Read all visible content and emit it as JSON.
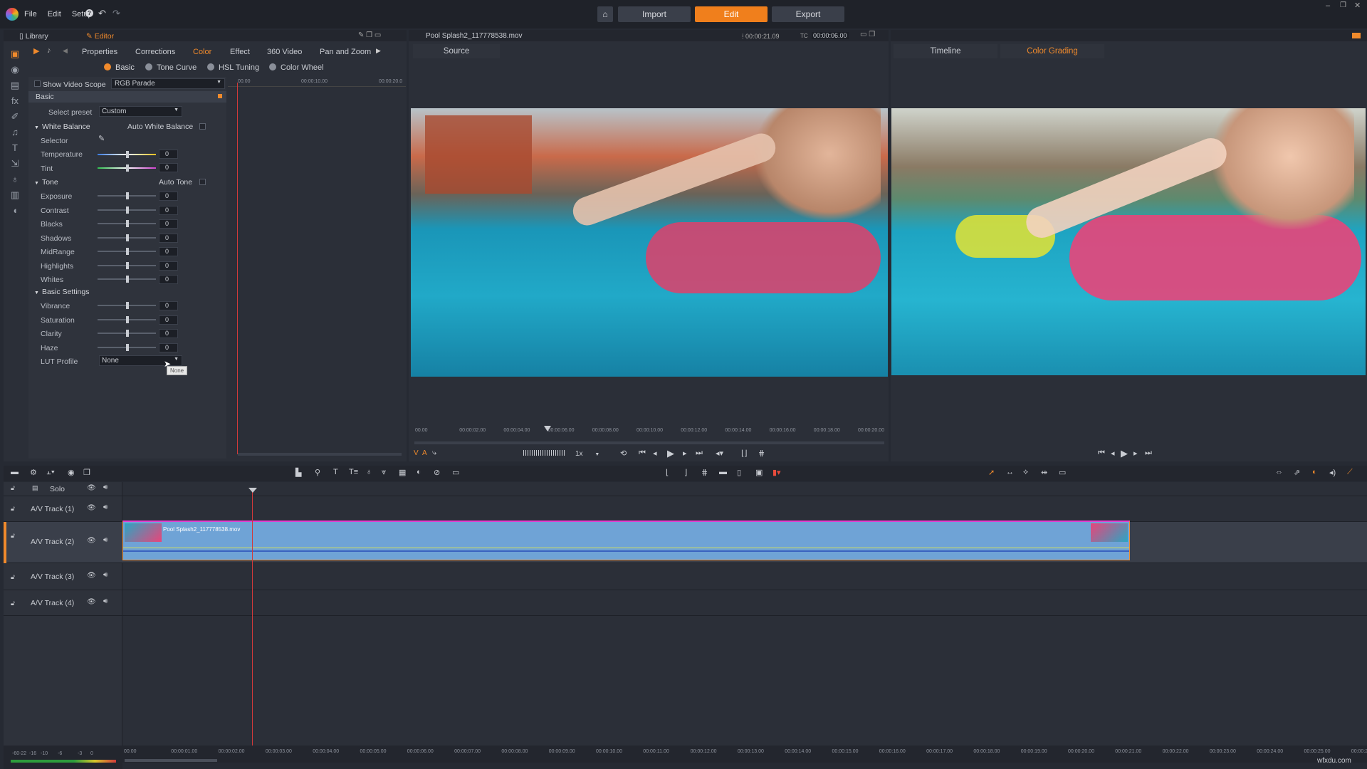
{
  "menu": {
    "file": "File",
    "edit": "Edit",
    "setup": "Setup",
    "help": "?"
  },
  "nav": {
    "import": "Import",
    "edit": "Edit",
    "export": "Export"
  },
  "left_tabs": {
    "library": "Library",
    "editor": "Editor"
  },
  "editor_tabs": [
    "Properties",
    "Corrections",
    "Color",
    "Effect",
    "360 Video",
    "Pan and Zoom"
  ],
  "color_subtabs": [
    "Basic",
    "Tone Curve",
    "HSL Tuning",
    "Color Wheel"
  ],
  "scope": {
    "label": "Show Video Scope",
    "value": "RGB Parade"
  },
  "basic_header": "Basic",
  "preset": {
    "label": "Select preset",
    "value": "Custom"
  },
  "white_balance": {
    "title": "White Balance",
    "auto": "Auto White Balance",
    "selector": "Selector",
    "temperature": "Temperature",
    "temperature_value": "0",
    "tint": "Tint",
    "tint_value": "0"
  },
  "tone": {
    "title": "Tone",
    "auto": "Auto Tone",
    "items": [
      {
        "label": "Exposure",
        "value": "0"
      },
      {
        "label": "Contrast",
        "value": "0"
      },
      {
        "label": "Blacks",
        "value": "0"
      },
      {
        "label": "Shadows",
        "value": "0"
      },
      {
        "label": "MidRange",
        "value": "0"
      },
      {
        "label": "Highlights",
        "value": "0"
      },
      {
        "label": "Whites",
        "value": "0"
      }
    ]
  },
  "basic_settings": {
    "title": "Basic Settings",
    "items": [
      {
        "label": "Vibrance",
        "value": "0"
      },
      {
        "label": "Saturation",
        "value": "0"
      },
      {
        "label": "Clarity",
        "value": "0"
      },
      {
        "label": "Haze",
        "value": "0"
      }
    ]
  },
  "lut": {
    "label": "LUT Profile",
    "value": "None",
    "tooltip": "None"
  },
  "scope_ruler": [
    "00.00",
    "00:00:10.00",
    "00:00:20.0"
  ],
  "source": {
    "filename": "Pool Splash2_117778538.mov",
    "duration": "00:00:21.09",
    "tc_label": "TC",
    "timecode": "00:00:06.00",
    "tab": "Source",
    "speed": "1x"
  },
  "source_ruler": [
    "00.00",
    "00:00:02.00",
    "00:00:04.00",
    "00:00:06.00",
    "00:00:08.00",
    "00:00:10.00",
    "00:00:12.00",
    "00:00:14.00",
    "00:00:16.00",
    "00:00:18.00",
    "00:00:20.00"
  ],
  "right_tabs": {
    "timeline": "Timeline",
    "color_grading": "Color Grading"
  },
  "tracks": [
    {
      "name": "Solo"
    },
    {
      "name": "A/V Track (1)"
    },
    {
      "name": "A/V Track (2)"
    },
    {
      "name": "A/V Track (3)"
    },
    {
      "name": "A/V Track (4)"
    }
  ],
  "clip": {
    "name": "Pool Splash2_117778538.mov"
  },
  "timeline_ruler": [
    "00.00",
    "00:00:01.00",
    "00:00:02.00",
    "00:00:03.00",
    "00:00:04.00",
    "00:00:05.00",
    "00:00:06.00",
    "00:00:07.00",
    "00:00:08.00",
    "00:00:09.00",
    "00:00:10.00",
    "00:00:11.00",
    "00:00:12.00",
    "00:00:13.00",
    "00:00:14.00",
    "00:00:15.00",
    "00:00:16.00",
    "00:00:17.00",
    "00:00:18.00",
    "00:00:19.00",
    "00:00:20.00",
    "00:00:21.00",
    "00:00:22.00",
    "00:00:23.00",
    "00:00:24.00",
    "00:00:25.00",
    "00:00:26.00"
  ],
  "audio_meter": [
    "-60",
    "-22",
    "-16",
    "-10",
    "-6",
    "-3",
    "0"
  ],
  "watermark": "wfxdu.com",
  "colors": {
    "accent": "#f07f1c",
    "clip": "#6fa3d6",
    "playhead": "#d13a3a"
  }
}
